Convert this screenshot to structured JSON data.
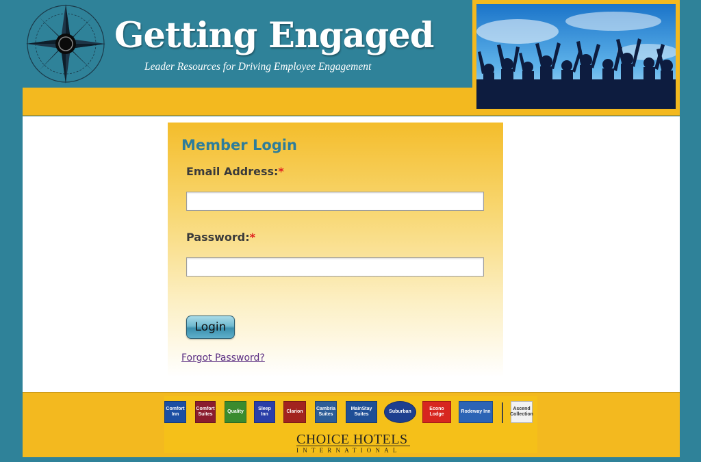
{
  "header": {
    "title": "Getting Engaged",
    "subtitle": "Leader Resources for Driving Employee Engagement"
  },
  "login": {
    "heading": "Member Login",
    "email_label": "Email Address:",
    "password_label": "Password:",
    "required_marker": "*",
    "email_value": "",
    "password_value": "",
    "login_button": "Login",
    "forgot_link": "Forgot Password?"
  },
  "footer": {
    "brands": [
      {
        "name": "Comfort Inn",
        "color": "#1c4fa3"
      },
      {
        "name": "Comfort Suites",
        "color": "#8a1c2e"
      },
      {
        "name": "Quality",
        "color": "#3a8b2e"
      },
      {
        "name": "Sleep Inn",
        "color": "#2a3fa8"
      },
      {
        "name": "Clarion",
        "color": "#a2231f"
      },
      {
        "name": "Cambria Suites",
        "color": "#2d5d97"
      },
      {
        "name": "MainStay Suites",
        "color": "#1f4f96"
      },
      {
        "name": "Suburban",
        "color": "#1e3f8f"
      },
      {
        "name": "Econo Lodge",
        "color": "#d7261f"
      },
      {
        "name": "Rodeway Inn",
        "color": "#2c64b5"
      },
      {
        "name": "Ascend Collection",
        "color": "#f2f2f2"
      }
    ],
    "company_name": "CHOICE HOTELS",
    "company_sub": "INTERNATIONAL"
  },
  "colors": {
    "frame": "#2f8299",
    "gold": "#f3b91f",
    "heading_blue": "#2e7d9a",
    "link": "#5a2d82",
    "required": "#e02020"
  },
  "icons": [
    "compass-logo-icon",
    "crowd-hero-image"
  ]
}
